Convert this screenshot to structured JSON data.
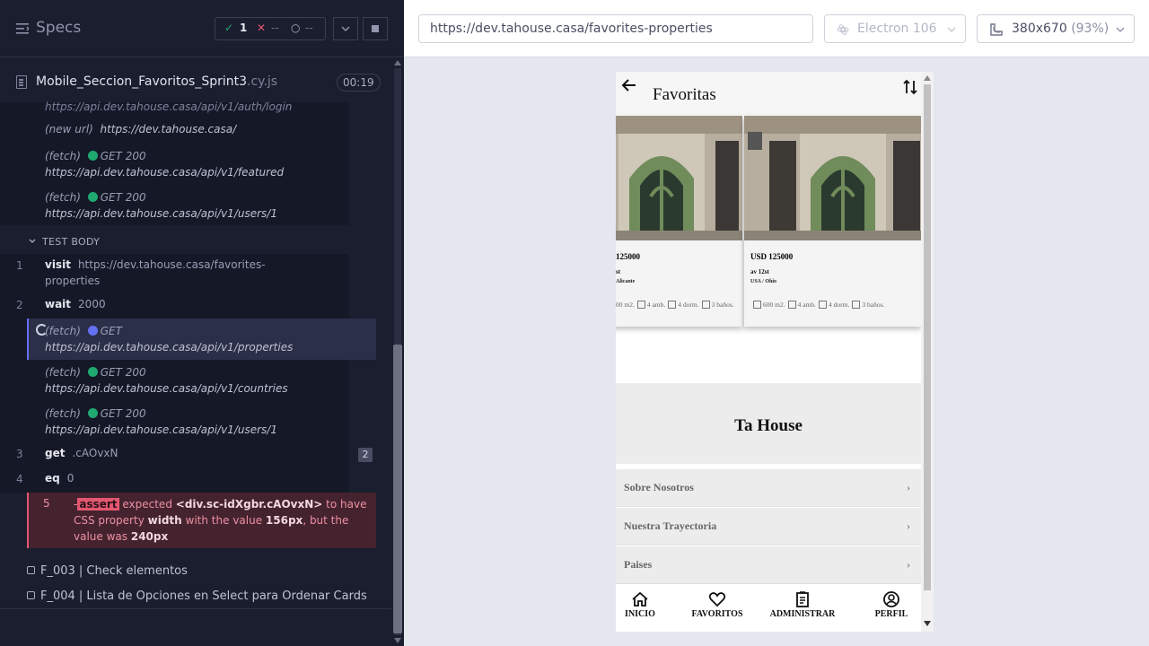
{
  "runner": {
    "title": "Specs",
    "stats": {
      "passed": "1",
      "failed": "--",
      "pending": "--"
    },
    "spec": {
      "name": "Mobile_Seccion_Favoritos_Sprint3",
      "ext": ".cy.js",
      "duration": "00:19"
    },
    "hooks": [
      {
        "text": "https://api.dev.tahouse.casa/api/v1/auth/login"
      },
      {
        "prefix": "(new url)",
        "url": "https://dev.tahouse.casa/"
      },
      {
        "prefix": "(fetch)",
        "method": "GET 200",
        "url": "https://api.dev.tahouse.casa/api/v1/featured"
      },
      {
        "prefix": "(fetch)",
        "method": "GET 200",
        "url": "https://api.dev.tahouse.casa/api/v1/users/1"
      }
    ],
    "test_body_label": "TEST BODY",
    "commands": [
      {
        "num": "1",
        "name": "visit",
        "arg1": "https://dev.tahouse.casa/favorites-",
        "arg2": "properties"
      },
      {
        "num": "2",
        "name": "wait",
        "arg1": "2000"
      },
      {
        "prefix": "(fetch)",
        "method": "GET",
        "url": "https://api.dev.tahouse.casa/api/v1/properties"
      },
      {
        "prefix": "(fetch)",
        "method": "GET 200",
        "url": "https://api.dev.tahouse.casa/api/v1/countries"
      },
      {
        "prefix": "(fetch)",
        "method": "GET 200",
        "url": "https://api.dev.tahouse.casa/api/v1/users/1"
      },
      {
        "num": "3",
        "name": "get",
        "arg1": ".cAOvxN",
        "badge": "2"
      },
      {
        "num": "4",
        "name": "eq",
        "arg1": "0"
      }
    ],
    "error": {
      "num": "5",
      "dash": "-",
      "tag": "assert",
      "w1": "expected",
      "el": "<div.sc-idXgbr.cAOvxN>",
      "w2": "to have CSS property",
      "prop": "width",
      "w3": "with the value",
      "expected": "156px",
      "w4": ", but the value was",
      "actual": "240px"
    },
    "tests": [
      "F_003 | Check elementos",
      "F_004 | Lista de Opciones en Select para Ordenar Cards"
    ]
  },
  "browser_bar": {
    "url": "https://dev.tahouse.casa/favorites-properties",
    "browser": "Electron 106",
    "viewport": "380x670",
    "zoom": "(93%)"
  },
  "app": {
    "title": "Favoritas",
    "cards": [
      {
        "price": "125000",
        "addr": "st",
        "loc": "Alicante",
        "m2": "00 m2.",
        "amb": "4 amb.",
        "dorm": "4 dorm.",
        "banos": "3 baños."
      },
      {
        "price": "USD 125000",
        "addr": "av 12st",
        "loc": "USA / Ohio",
        "m2": "600 m2.",
        "amb": "4 amb.",
        "dorm": "4 dorm.",
        "banos": "3 baños."
      }
    ],
    "brand": "Ta House",
    "accordion": [
      "Sobre Nosotros",
      "Nuestra Trayectoria",
      "Paises"
    ],
    "nav": [
      "INICIO",
      "FAVORITOS",
      "ADMINISTRAR",
      "PERFIL"
    ]
  },
  "colors": {
    "pass": "#1fa971",
    "fail": "#e45770",
    "running": "#6470f3",
    "runner_bg": "#1b1e2e"
  }
}
